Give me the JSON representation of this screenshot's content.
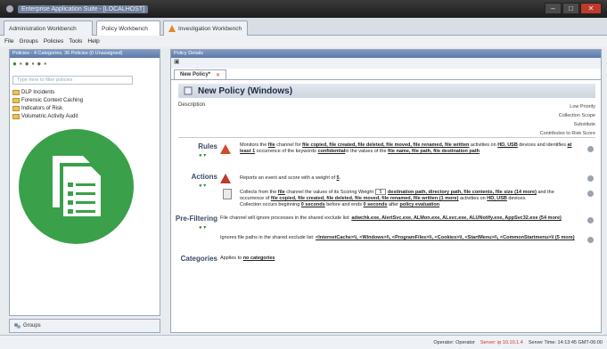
{
  "window": {
    "title": "Enterprise Application Suite - [LOCALHOST]",
    "controls": [
      "–",
      "□",
      "✕"
    ]
  },
  "workbench_tabs": [
    {
      "label": "Administration Workbench"
    },
    {
      "label": "Policy Workbench"
    },
    {
      "label": "Investigation Workbench"
    }
  ],
  "menu": [
    "File",
    "Groups",
    "Policies",
    "Tools",
    "Help"
  ],
  "left_panel": {
    "header": "Policies - 4 Categories, 36 Policies (0 Unassigned)",
    "search_placeholder": "Type here to filter policies",
    "tree": [
      "DLP Incidents",
      "Forensic Context Caching",
      "Indicators of Risk",
      "Volumetric Activity Audit"
    ],
    "groups_label": "Groups"
  },
  "right_panel": {
    "header": "Policy Details",
    "doc_tab": "New Policy*",
    "doc_tab_close": "✕",
    "policy_title": "New Policy (Windows)",
    "description_label": "Description",
    "options": [
      "Low Priority",
      "Collection Scope",
      "Substitute",
      "Contributes to Risk Score"
    ],
    "rules_label": "Rules",
    "rules_text_1": "Monitors the",
    "rules_text_file": "file",
    "rules_text_2": "channel for",
    "rules_events": "file copied, file created, file deleted, file moved, file renamed, file written",
    "rules_text_3": "activities on",
    "rules_devices": "HD, USB",
    "rules_text_4": "devices and identifies",
    "rules_count": "at least 1",
    "rules_text_5": "occurrence of the keywords",
    "rules_keyword": "confidential",
    "rules_text_6": "in the values of the",
    "rules_fields": "file name, file path, file destination path",
    "actions_label": "Actions",
    "action1_text": "Reports an event and score with a weight of",
    "action1_weight": "5",
    "action2_prefix": "Collects from the",
    "action2_channel": "file",
    "action2_mid": "channel the values of its",
    "action2_score_label": "Scoring Weight",
    "action2_score_value": "5",
    "action2_fields": "destination path, directory path, file contents, file size (14 more)",
    "action2_mid2": "and the occurrence of",
    "action2_events": "file copied, file created, file deleted, file moved, file renamed, file written (1 more)",
    "action2_mid3": "activities on",
    "action2_devices": "HD, USB",
    "action2_suffix": "devices.",
    "action2_line3a": "Collection occurs beginning",
    "action2_before": "0 seconds",
    "action2_line3b": "before and ends",
    "action2_after": "0 seconds",
    "action2_line3c": "after",
    "action2_eval": "policy evaluation",
    "prefilter_label": "Pre-Filtering",
    "prefilter1_text": "File channel will ignore processes in the shared exclude list:",
    "prefilter1_list": "adwchk.exe, AlertSvc.exe, ALMon.exe, ALsvc.exe, ALUNotify.exe, AppSvc32.exe (54 more)",
    "prefilter2_text": "Ignores file paths in the shared exclude list:",
    "prefilter2_list": "<InternetCache>\\\\, <Windows>\\\\, <ProgramFiles>\\\\, <Cookies>\\\\, <StartMenu>\\\\, <CommonStartmenu>\\\\ (5 more)",
    "categories_label": "Categories",
    "categories_text": "Applies to",
    "categories_value": "no categories"
  },
  "status": {
    "operator": "Operator: Operator",
    "server": "Server: ip 10.10.1.4",
    "time": "Server Time: 14:13:45 GMT-06:00"
  },
  "colors": {
    "overlay_green": "#3aa04a",
    "title_blue": "#1d2a44"
  },
  "icons": [
    "app-icon",
    "policy-documents-icon",
    "warning-icon",
    "document-icon",
    "gear-icon",
    "folder-icon"
  ]
}
